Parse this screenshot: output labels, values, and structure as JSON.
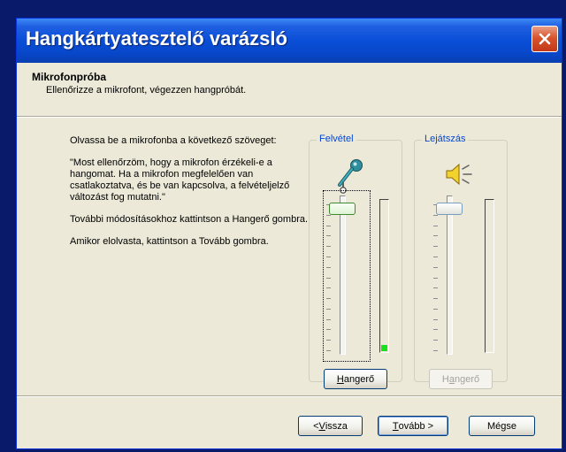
{
  "window": {
    "title": "Hangkártyatesztelő varázsló",
    "close_icon": "close-icon"
  },
  "header": {
    "title": "Mikrofonpróba",
    "subtitle": "Ellenőrizze a mikrofont, végezzen hangpróbát."
  },
  "instructions": {
    "intro": "Olvassa be a mikrofonba a következő szöveget:",
    "quote": "\"Most ellenőrzöm, hogy a mikrofon érzékeli-e a hangomat. Ha a mikrofon megfelelően van csatlakoztatva, és be van kapcsolva, a felvételjelző változást fog mutatni.\"",
    "volume_hint": "További módosításokhoz kattintson a Hangerő gombra.",
    "next_hint": "Amikor elolvasta, kattintson a Tovább gombra."
  },
  "recording": {
    "label": "Felvétel",
    "icon": "microphone-icon",
    "slider_level": 0.95,
    "meter_level": 0.04,
    "volume_button": {
      "underlined": "H",
      "rest": "angerő",
      "enabled": true
    }
  },
  "playback": {
    "label": "Lejátszás",
    "icon": "speaker-icon",
    "slider_level": 0.95,
    "meter_level": 0.0,
    "volume_button": {
      "prefix": "H",
      "underlined": "a",
      "rest": "ngerő",
      "enabled": false
    }
  },
  "footer": {
    "back": {
      "prefix": "< ",
      "underlined": "V",
      "rest": "issza"
    },
    "next": {
      "underlined": "T",
      "rest": "ovább >"
    },
    "cancel": {
      "label": "Mégse"
    }
  },
  "colors": {
    "title_bar": "#0a4fd8",
    "group_label": "#0046d5",
    "meter_fill": "#19e01d",
    "close_button": "#d8542c"
  }
}
